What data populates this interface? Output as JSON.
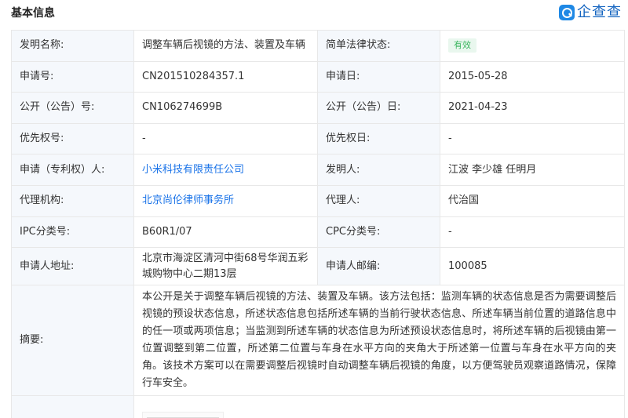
{
  "header": {
    "title": "基本信息",
    "logo_text": "企查查"
  },
  "rows": {
    "invention_name": {
      "label": "发明名称:",
      "value": "调整车辆后视镜的方法、装置及车辆"
    },
    "legal_status": {
      "label": "简单法律状态:",
      "value": "有效"
    },
    "app_no": {
      "label": "申请号:",
      "value": "CN201510284357.1"
    },
    "app_date": {
      "label": "申请日:",
      "value": "2015-05-28"
    },
    "pub_no": {
      "label": "公开（公告）号:",
      "value": "CN106274699B"
    },
    "pub_date": {
      "label": "公开（公告）日:",
      "value": "2021-04-23"
    },
    "priority_no": {
      "label": "优先权号:",
      "value": "-"
    },
    "priority_date": {
      "label": "优先权日:",
      "value": "-"
    },
    "applicant": {
      "label": "申请（专利权）人:",
      "value": "小米科技有限责任公司"
    },
    "inventor": {
      "label": "发明人:",
      "value": "江波 李少雄 任明月"
    },
    "agency": {
      "label": "代理机构:",
      "value": "北京尚伦律师事务所"
    },
    "agent": {
      "label": "代理人:",
      "value": "代治国"
    },
    "ipc": {
      "label": "IPC分类号:",
      "value": "B60R1/07"
    },
    "cpc": {
      "label": "CPC分类号:",
      "value": "-"
    },
    "address": {
      "label": "申请人地址:",
      "value": "北京市海淀区清河中街68号华润五彩城购物中心二期13层"
    },
    "postcode": {
      "label": "申请人邮编:",
      "value": "100085"
    },
    "abstract": {
      "label": "摘要:",
      "value": "本公开是关于调整车辆后视镜的方法、装置及车辆。该方法包括：监测车辆的状态信息是否为需要调整后视镜的预设状态信息，所述状态信息包括所述车辆的当前行驶状态信息、所述车辆当前位置的道路信息中的任一项或两项信息；当监测到所述车辆的状态信息为所述预设状态信息时，将所述车辆的后视镜由第一位置调整到第二位置，所述第二位置与车身在水平方向的夹角大于所述第一位置与车身在水平方向的夹角。该技术方案可以在需要调整后视镜时自动调整车辆后视镜的角度，以方便驾驶员观察道路情况，保障行车安全。"
    }
  },
  "colors": {
    "label_bg": "#f5f8fc",
    "link": "#1a73e8",
    "badge_bg": "#e9f7ee",
    "badge_text": "#3bb55e",
    "border": "#e8e8e8"
  }
}
